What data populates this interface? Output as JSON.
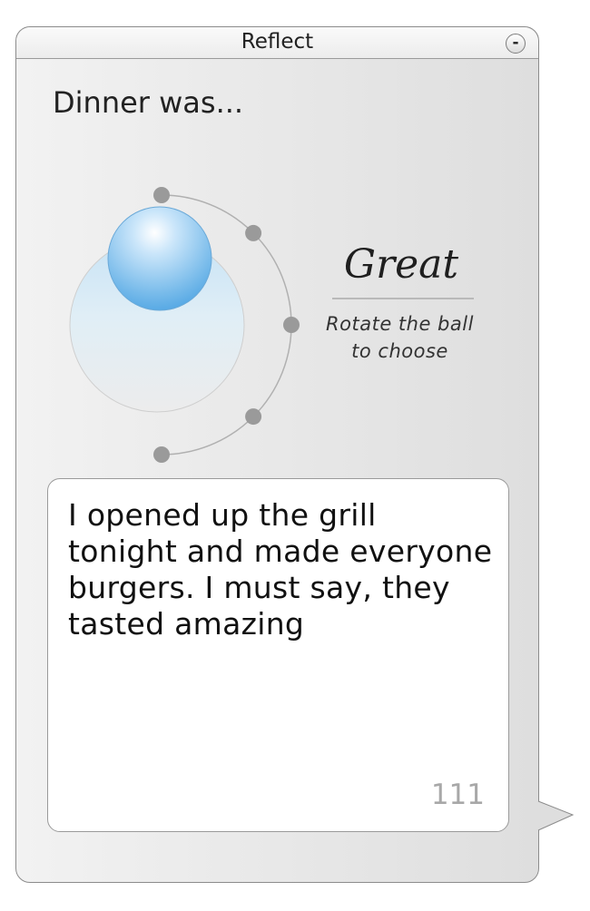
{
  "window": {
    "title": "Reflect",
    "minimize_label": "-"
  },
  "prompt": {
    "text": "Dinner was..."
  },
  "rating": {
    "selected": "Great",
    "hint_line1": "Rotate the ball",
    "hint_line2": "to choose",
    "option_count": 5,
    "selected_index": 0
  },
  "entry": {
    "text": "I opened up the grill tonight and made everyone burgers. I must say, they tasted amazing",
    "char_remaining": "111"
  },
  "colors": {
    "ball": "#5aaee8",
    "stop": "#9a9a9a",
    "track": "#b0b0b0",
    "counter": "#a8a8a8"
  }
}
